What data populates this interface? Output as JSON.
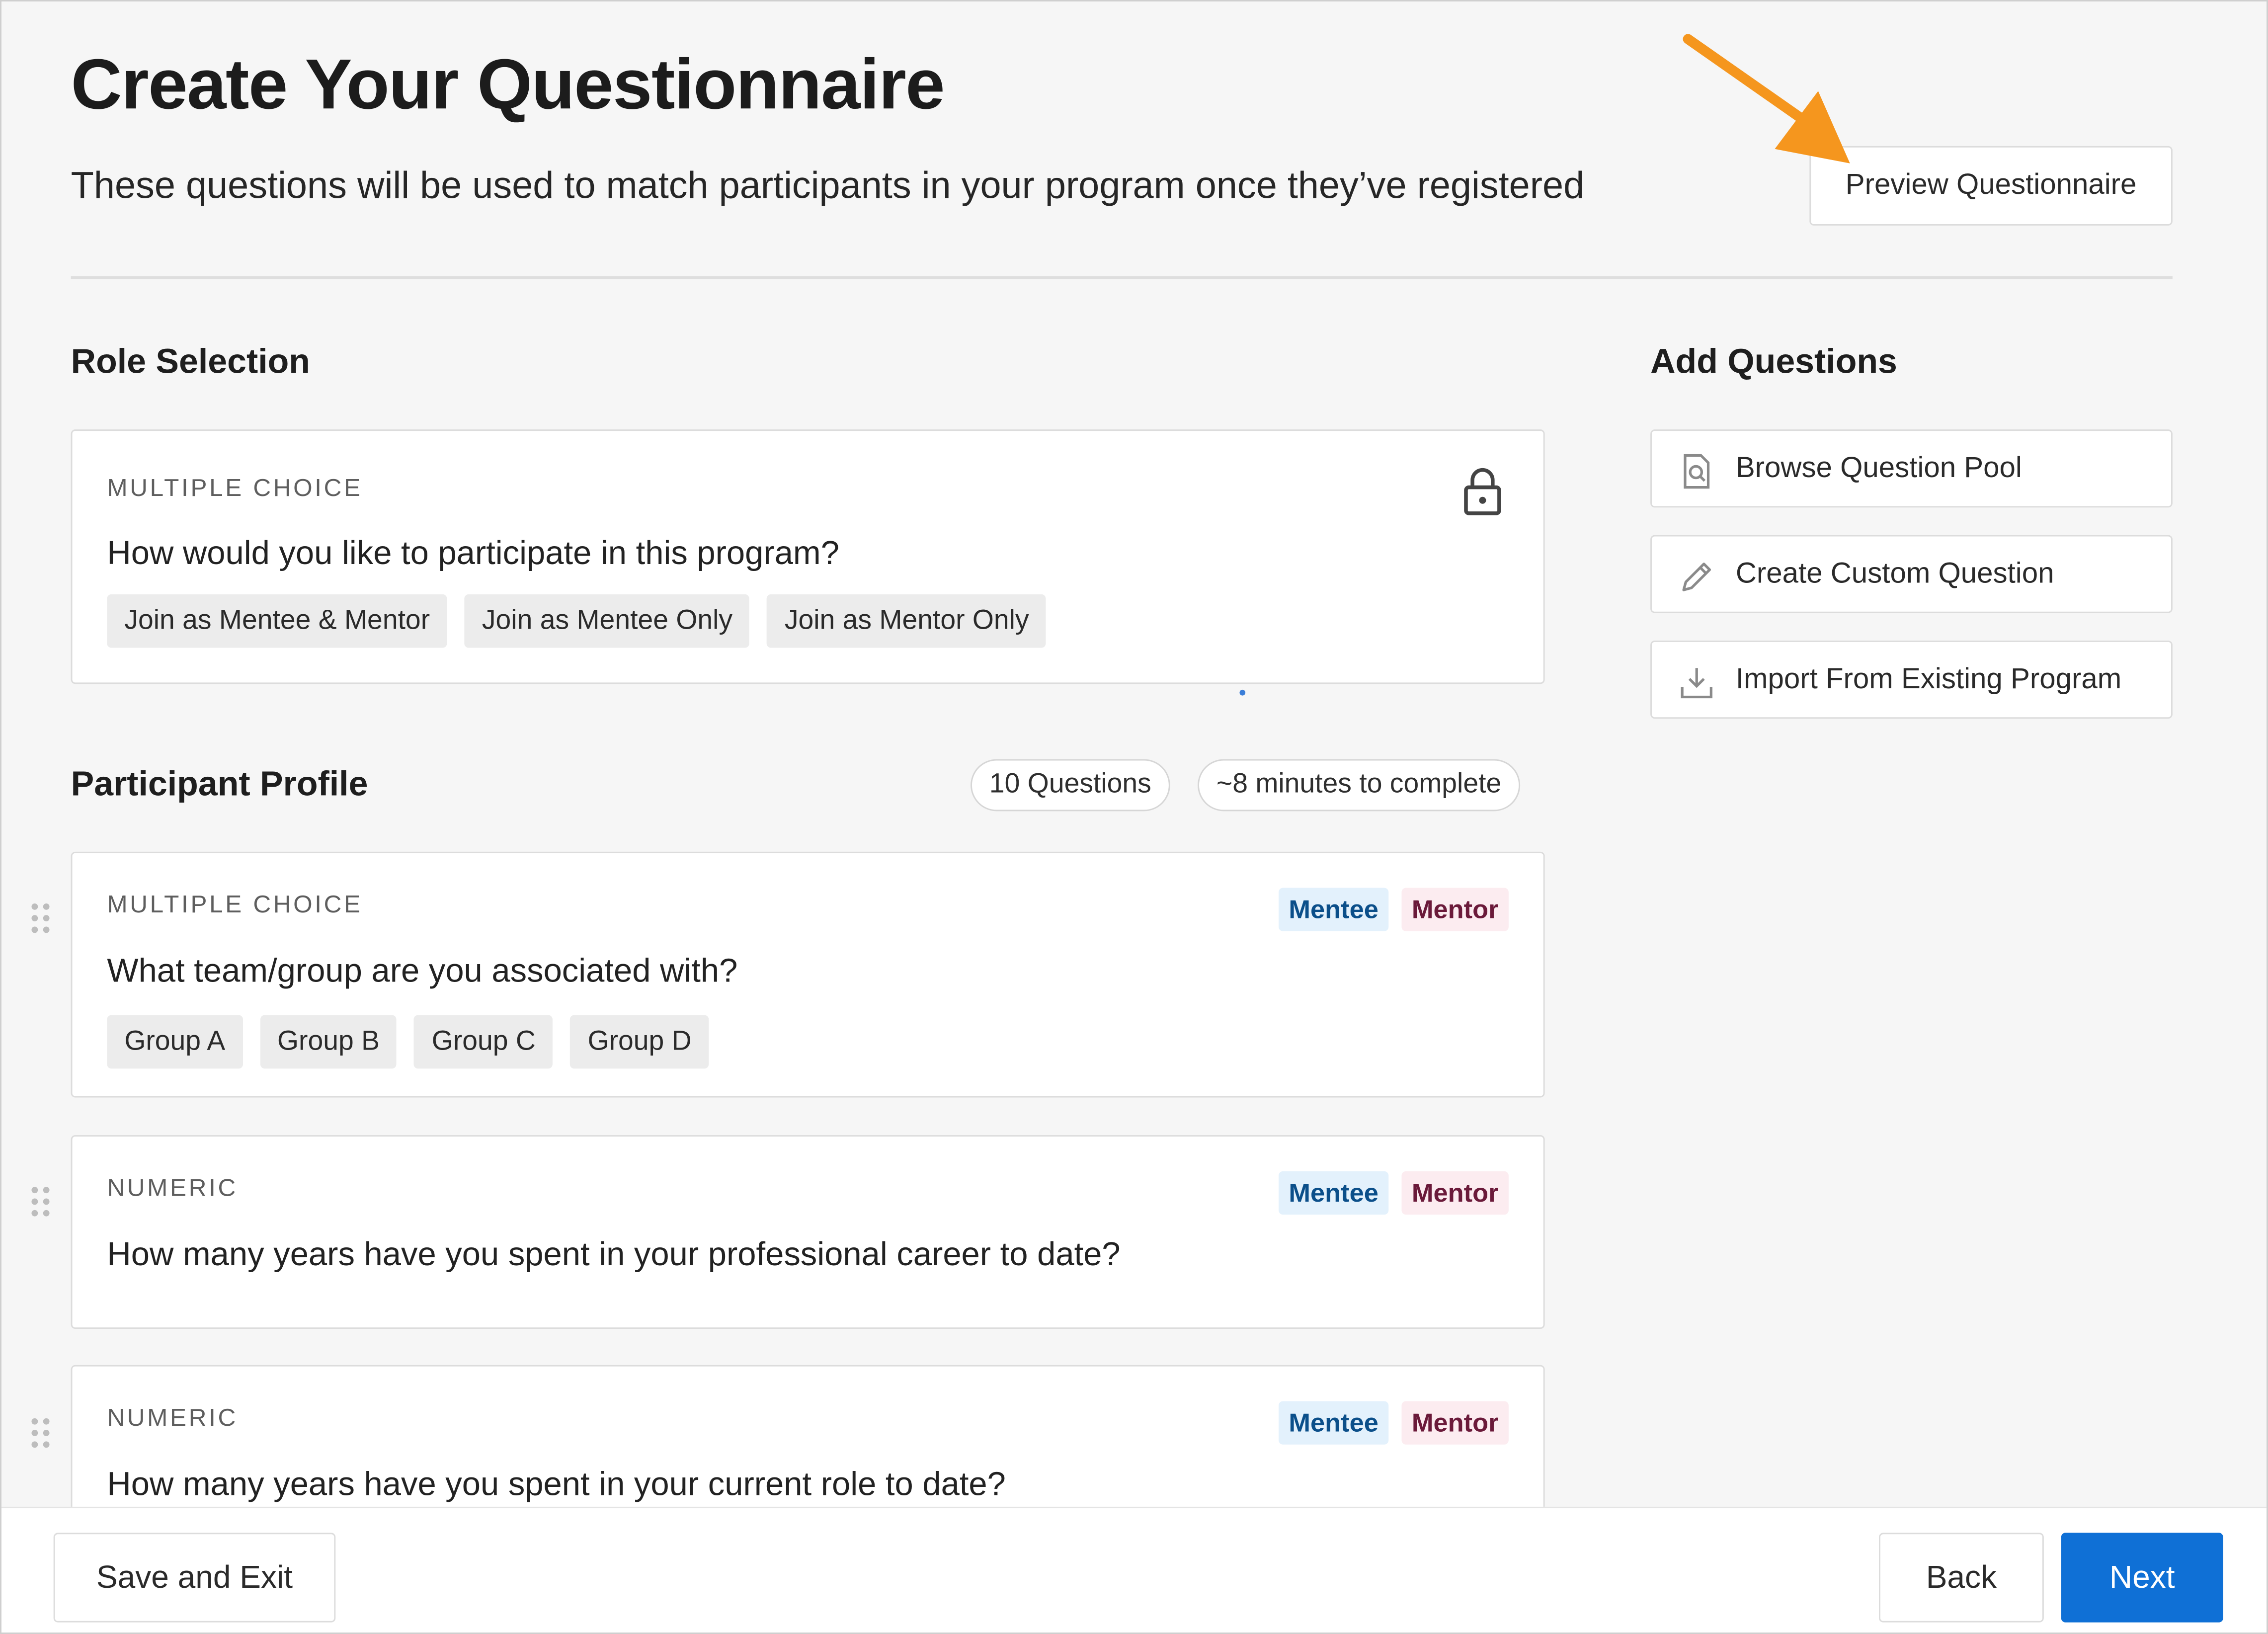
{
  "header": {
    "title": "Create Your Questionnaire",
    "subtitle": "These questions will be used to match participants in your program once they’ve registered",
    "preview_button": "Preview Questionnaire"
  },
  "role_selection": {
    "heading": "Role Selection",
    "question": {
      "type": "MULTIPLE CHOICE",
      "text": "How would you like to participate in this program?",
      "options": [
        "Join as Mentee & Mentor",
        "Join as Mentee Only",
        "Join as Mentor Only"
      ],
      "icon": "lock-icon"
    }
  },
  "participant_profile": {
    "heading": "Participant Profile",
    "question_count": "10 Questions",
    "time_estimate": "~8 minutes to complete",
    "questions": [
      {
        "type": "MULTIPLE CHOICE",
        "text": "What team/group are you associated with?",
        "options": [
          "Group A",
          "Group B",
          "Group C",
          "Group D"
        ],
        "tags": [
          "Mentee",
          "Mentor"
        ]
      },
      {
        "type": "NUMERIC",
        "text": "How many years have you spent in your professional career to date?",
        "tags": [
          "Mentee",
          "Mentor"
        ]
      },
      {
        "type": "NUMERIC",
        "text": "How many years have you spent in your current role to date?",
        "tags": [
          "Mentee",
          "Mentor"
        ]
      }
    ]
  },
  "add_questions": {
    "heading": "Add Questions",
    "actions": [
      {
        "label": "Browse Question Pool",
        "icon": "document-search-icon"
      },
      {
        "label": "Create Custom Question",
        "icon": "pencil-icon"
      },
      {
        "label": "Import From Existing Program",
        "icon": "download-icon"
      }
    ]
  },
  "footer": {
    "save_exit": "Save and Exit",
    "back": "Back",
    "next": "Next"
  },
  "colors": {
    "primary": "#0f70d6",
    "mentee_bg": "#e3f1fc",
    "mentee_text": "#0b4f8a",
    "mentor_bg": "#fcecf0",
    "mentor_text": "#6b1a3a",
    "annotation_arrow": "#f5961e"
  }
}
